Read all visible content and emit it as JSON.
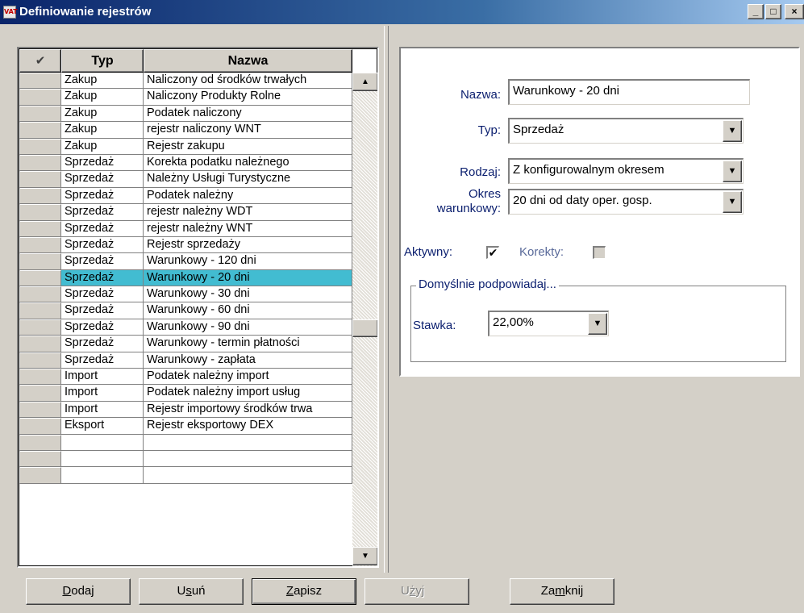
{
  "window": {
    "icon_text": "VAT",
    "title": "Definiowanie rejestrów",
    "minimize_glyph": "_",
    "maximize_glyph": "□",
    "close_glyph": "×"
  },
  "grid": {
    "header_icon": "✔",
    "columns": [
      "Typ",
      "Nazwa"
    ],
    "selected_index": 12,
    "rows": [
      {
        "typ": "Zakup",
        "nazwa": "Naliczony od środków trwałych"
      },
      {
        "typ": "Zakup",
        "nazwa": "Naliczony Produkty Rolne"
      },
      {
        "typ": "Zakup",
        "nazwa": "Podatek naliczony"
      },
      {
        "typ": "Zakup",
        "nazwa": "rejestr naliczony WNT"
      },
      {
        "typ": "Zakup",
        "nazwa": "Rejestr zakupu"
      },
      {
        "typ": "Sprzedaż",
        "nazwa": "Korekta podatku należnego"
      },
      {
        "typ": "Sprzedaż",
        "nazwa": "Należny Usługi Turystyczne"
      },
      {
        "typ": "Sprzedaż",
        "nazwa": "Podatek należny"
      },
      {
        "typ": "Sprzedaż",
        "nazwa": "rejestr należny WDT"
      },
      {
        "typ": "Sprzedaż",
        "nazwa": "rejestr należny WNT"
      },
      {
        "typ": "Sprzedaż",
        "nazwa": "Rejestr sprzedaży"
      },
      {
        "typ": "Sprzedaż",
        "nazwa": "Warunkowy - 120 dni"
      },
      {
        "typ": "Sprzedaż",
        "nazwa": "Warunkowy - 20 dni"
      },
      {
        "typ": "Sprzedaż",
        "nazwa": "Warunkowy - 30 dni"
      },
      {
        "typ": "Sprzedaż",
        "nazwa": "Warunkowy - 60 dni"
      },
      {
        "typ": "Sprzedaż",
        "nazwa": "Warunkowy - 90 dni"
      },
      {
        "typ": "Sprzedaż",
        "nazwa": "Warunkowy - termin płatności"
      },
      {
        "typ": "Sprzedaż",
        "nazwa": "Warunkowy - zapłata"
      },
      {
        "typ": "Import",
        "nazwa": "Podatek należny import"
      },
      {
        "typ": "Import",
        "nazwa": "Podatek należny import usług"
      },
      {
        "typ": "Import",
        "nazwa": "Rejestr importowy środków trwa"
      },
      {
        "typ": "Eksport",
        "nazwa": "Rejestr eksportowy DEX"
      },
      {
        "typ": "",
        "nazwa": ""
      },
      {
        "typ": "",
        "nazwa": ""
      },
      {
        "typ": "",
        "nazwa": ""
      }
    ],
    "scroll_up_glyph": "▲",
    "scroll_down_glyph": "▼"
  },
  "form": {
    "nazwa_label": "Nazwa:",
    "nazwa_value": "Warunkowy - 20 dni",
    "typ_label": "Typ:",
    "typ_value": "Sprzedaż",
    "rodzaj_label": "Rodzaj:",
    "rodzaj_value": "Z konfigurowalnym okresem",
    "okres_label_1": "Okres",
    "okres_label_2": "warunkowy:",
    "okres_value": "20 dni od daty oper. gosp.",
    "aktywny_label": "Aktywny:",
    "aktywny_checked": true,
    "korekty_label": "Korekty:",
    "korekty_checked": false,
    "group_title": "Domyślnie podpowiadaj...",
    "stawka_label": "Stawka:",
    "stawka_value": "22,00%",
    "dropdown_glyph": "▼",
    "check_glyph": "✔"
  },
  "buttons": {
    "dodaj": {
      "before": "",
      "u": "D",
      "after": "odaj"
    },
    "usun": {
      "before": "U",
      "u": "s",
      "after": "uń"
    },
    "zapisz": {
      "before": "",
      "u": "Z",
      "after": "apisz"
    },
    "uzyj": {
      "before": "U",
      "u": "ż",
      "after": "yj"
    },
    "zamknij": {
      "before": "Za",
      "u": "m",
      "after": "knij"
    }
  }
}
